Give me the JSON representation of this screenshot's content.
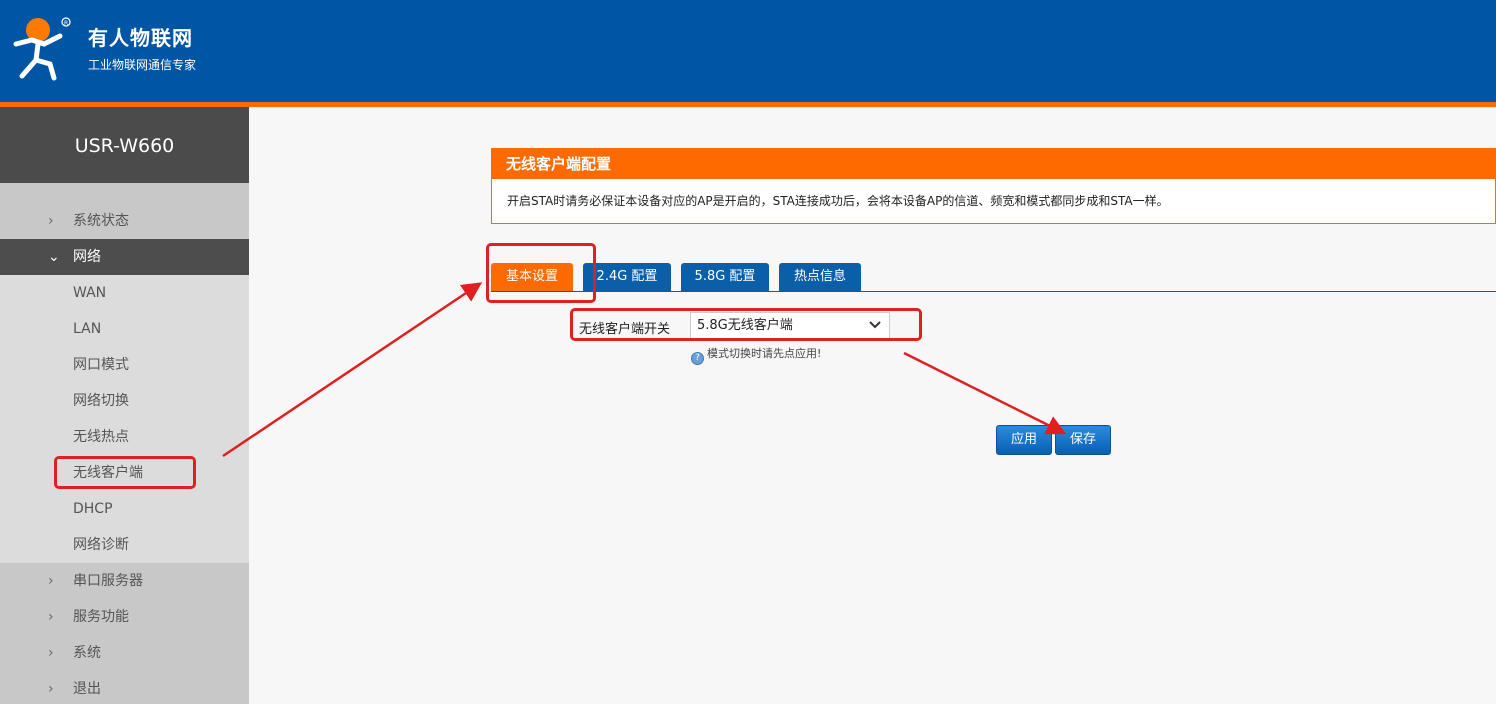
{
  "header": {
    "brand_name": "有人物联网",
    "brand_slogan": "工业物联网通信专家",
    "logo_icon": "usr-logo-icon",
    "colors": {
      "header_bg": "#0055a5",
      "stripe": "#ff6a00"
    }
  },
  "sidebar": {
    "device_name": "USR-W660",
    "menu": [
      {
        "label": "系统状态",
        "icon": "chevron-right-icon"
      },
      {
        "label": "网络",
        "icon": "chevron-down-icon",
        "expanded": true,
        "children": [
          "WAN",
          "LAN",
          "网口模式",
          "网络切换",
          "无线热点",
          "无线客户端",
          "DHCP",
          "网络诊断"
        ]
      },
      {
        "label": "串口服务器",
        "icon": "chevron-right-icon"
      },
      {
        "label": "服务功能",
        "icon": "chevron-right-icon"
      },
      {
        "label": "系统",
        "icon": "chevron-right-icon"
      },
      {
        "label": "退出",
        "icon": "chevron-right-icon"
      }
    ]
  },
  "panel": {
    "title": "无线客户端配置",
    "note": "开启STA时请务必保证本设备对应的AP是开启的，STA连接成功后，会将本设备AP的信道、频宽和模式都同步成和STA一样。"
  },
  "tabs": [
    "基本设置",
    "2.4G 配置",
    "5.8G 配置",
    "热点信息"
  ],
  "active_tab": "基本设置",
  "form": {
    "switch_label": "无线客户端开关",
    "switch_value": "5.8G无线客户端",
    "hint": "模式切换时请先点应用!"
  },
  "buttons": {
    "apply": "应用",
    "save": "保存"
  },
  "annotation_color": "#e02020"
}
